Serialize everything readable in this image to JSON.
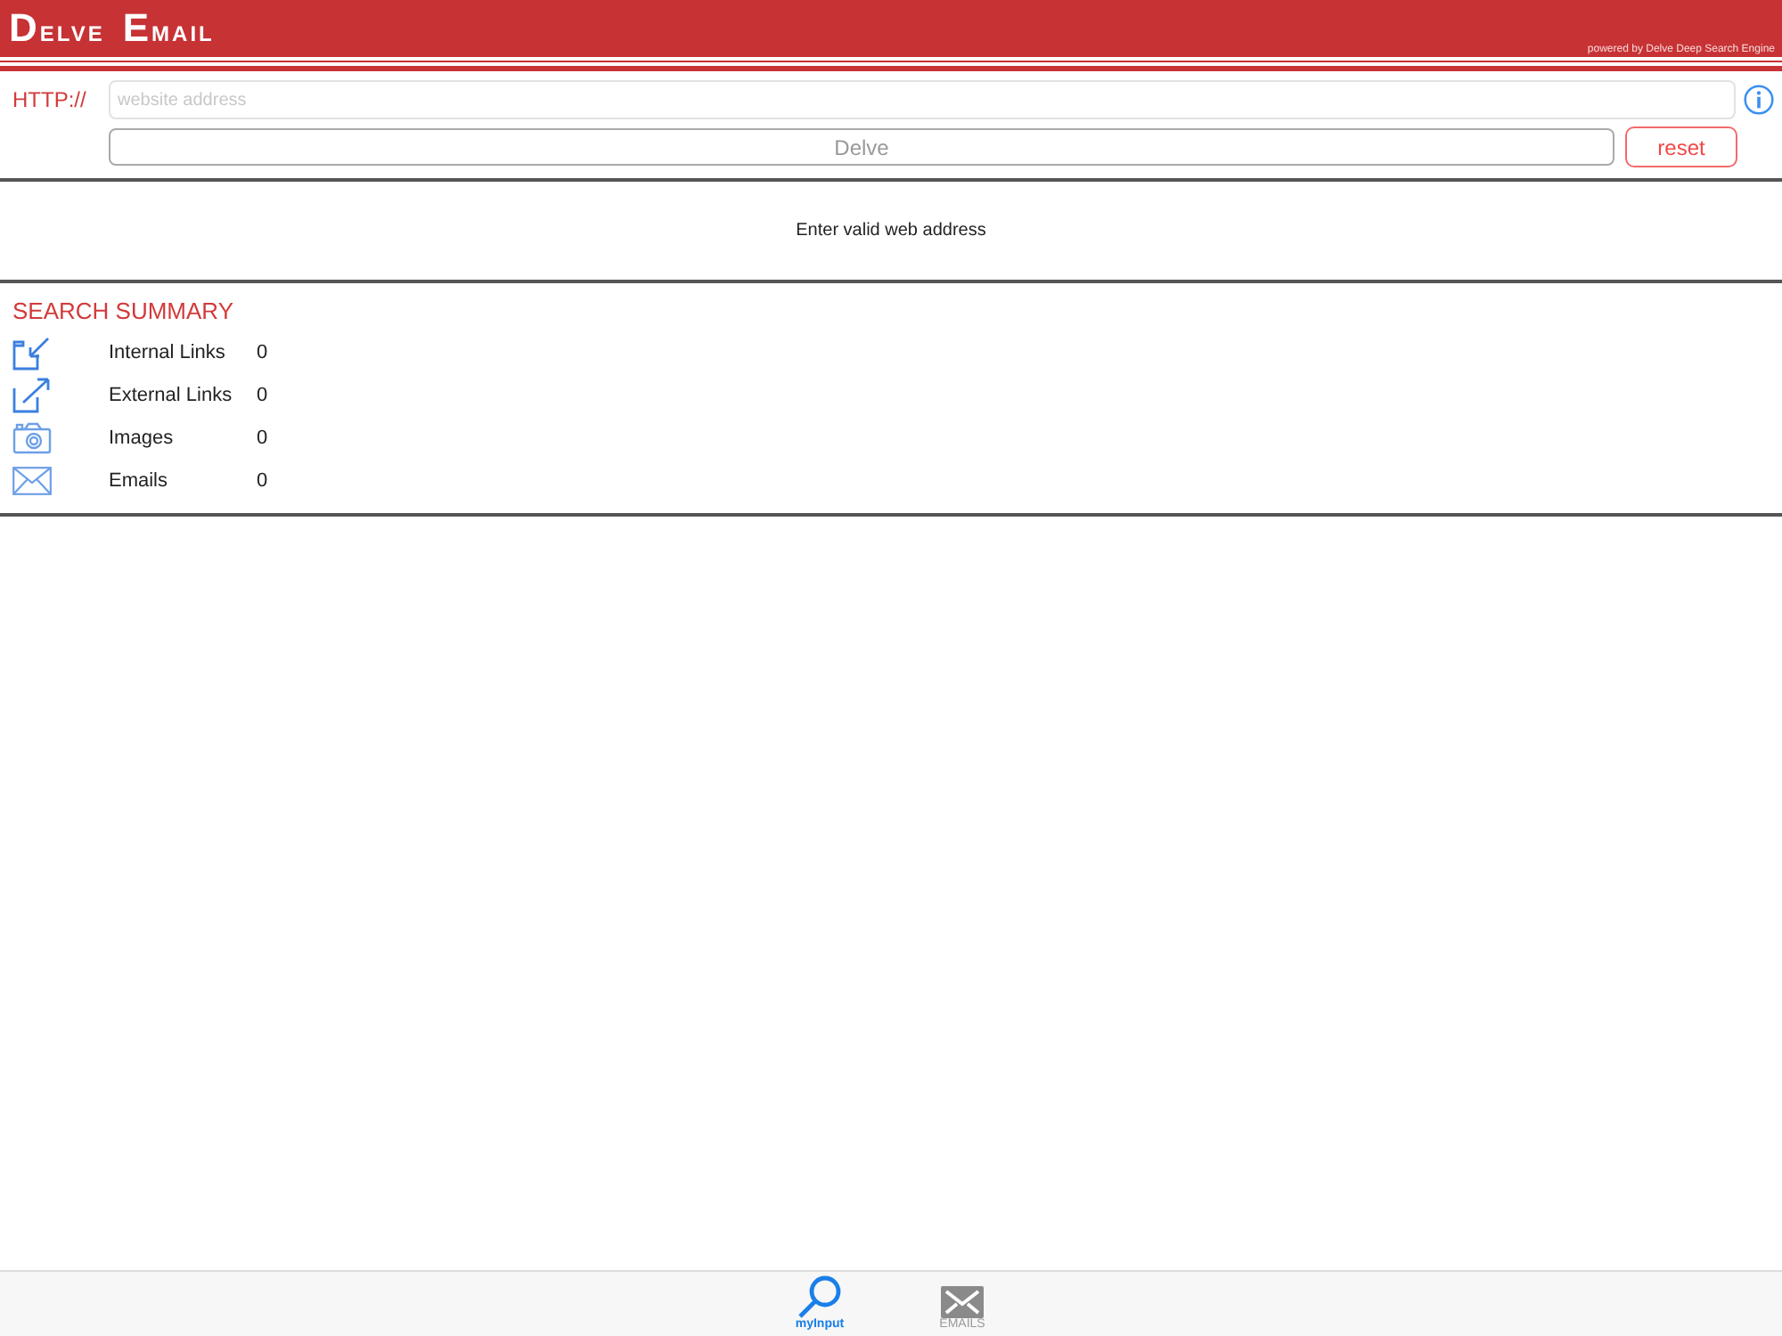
{
  "header": {
    "title_words": [
      "DELVE",
      "EMAIL"
    ],
    "tagline": "powered by Delve Deep Search Engine"
  },
  "form": {
    "prefix": "HTTP://",
    "url_field": {
      "placeholder": "website address"
    },
    "delve_button": "Delve",
    "reset_button": "reset"
  },
  "message": "Enter valid web address",
  "summary": {
    "title": "SEARCH SUMMARY",
    "rows": [
      {
        "kind": "internal",
        "label": "Internal Links",
        "count": "0"
      },
      {
        "kind": "external",
        "label": "External Links",
        "count": "0"
      },
      {
        "kind": "images",
        "label": "Images",
        "count": "0"
      },
      {
        "kind": "emails",
        "label": "Emails",
        "count": "0"
      }
    ]
  },
  "tab_bar": [
    {
      "kind": "search",
      "label": "myInput",
      "selected": true
    },
    {
      "kind": "mail",
      "label": "EMAILS",
      "selected": false
    }
  ]
}
